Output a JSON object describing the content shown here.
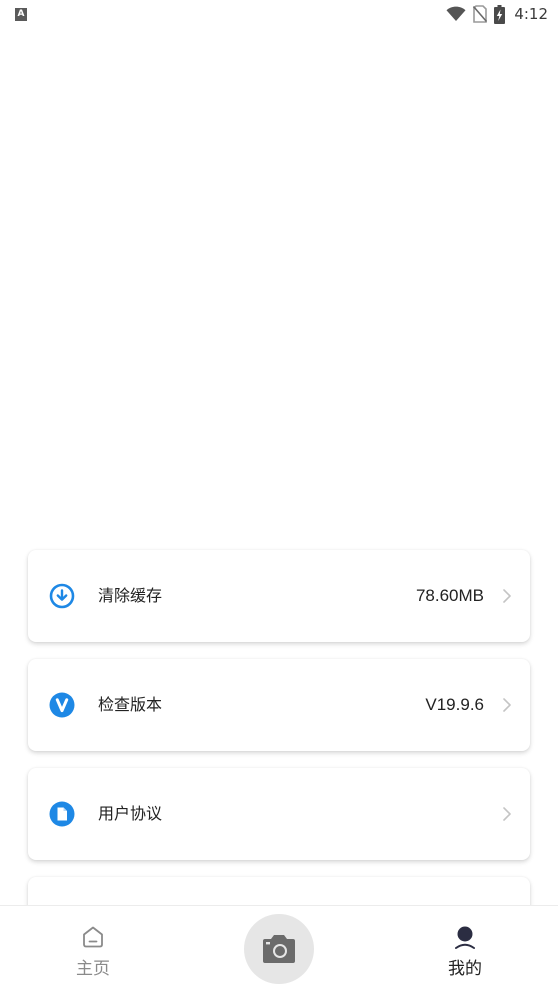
{
  "status_bar": {
    "indicator": "A",
    "time": "4:12",
    "icons": [
      "wifi-icon",
      "no-sim-icon",
      "battery-charging-icon"
    ]
  },
  "settings": [
    {
      "label": "清除缓存",
      "value": "78.60MB",
      "icon": "download-circle-icon"
    },
    {
      "label": "检查版本",
      "value": "V19.9.6",
      "icon": "version-v-icon"
    },
    {
      "label": "用户协议",
      "value": "",
      "icon": "document-icon"
    }
  ],
  "bottom_nav": {
    "home_label": "主页",
    "mine_label": "我的",
    "camera_icon": "camera-icon"
  },
  "colors": {
    "accent": "#1e88e5",
    "text": "#222222",
    "muted": "#8a8a8a",
    "nav_active_icon": "#2b2d42"
  }
}
